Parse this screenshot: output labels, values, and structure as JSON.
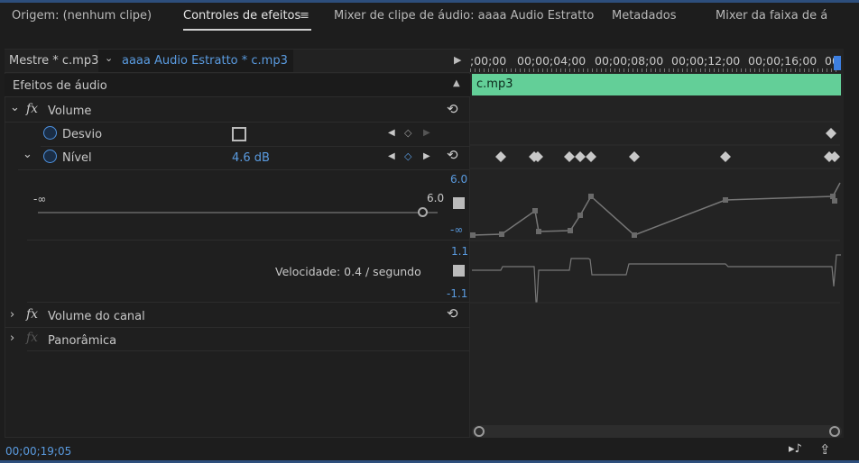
{
  "tabs": [
    {
      "label": "Origem: (nenhum clipe)"
    },
    {
      "label": "Controles de efeitos"
    },
    {
      "label": "Mixer de clipe de áudio: aaaa Audio Estratto"
    },
    {
      "label": "Metadados"
    },
    {
      "label": "Mixer da faixa de á"
    }
  ],
  "header": {
    "master": "Mestre * c.mp3",
    "clip": "aaaa Audio Estratto * c.mp3"
  },
  "section": "Efeitos de áudio",
  "effects": {
    "volume": "Volume",
    "desvio": "Desvio",
    "nivel": "Nível",
    "nivel_value": "4.6 dB",
    "slider_min": "-∞",
    "slider_max": "6.0",
    "graph_max": "6.0",
    "graph_min": "-∞",
    "velocity": "Velocidade: 0.4 / segundo",
    "vel_max": "1.1",
    "vel_min": "-1.1",
    "channel_volume": "Volume do canal",
    "panoramica": "Panorâmica"
  },
  "timeline": {
    "ticks": [
      ";00;00",
      "00;00;04;00",
      "00;00;08;00",
      "00;00;12;00",
      "00;00;16;00",
      "00"
    ],
    "clip_name": "c.mp3"
  },
  "status": {
    "timecode": "00;00;19;05"
  },
  "colors": {
    "accent": "#5a9be0",
    "clip": "#63cf98"
  }
}
